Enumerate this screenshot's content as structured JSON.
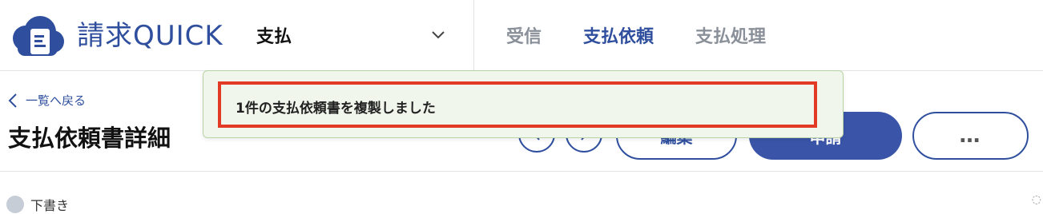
{
  "app": {
    "name": "請求QUICK"
  },
  "header": {
    "module_select": {
      "value": "支払"
    },
    "nav": [
      {
        "label": "受信",
        "active": false
      },
      {
        "label": "支払依頼",
        "active": true
      },
      {
        "label": "支払処理",
        "active": false
      }
    ]
  },
  "page": {
    "back_link": "一覧へ戻る",
    "title": "支払依頼書詳細"
  },
  "actions": {
    "edit_label": "編集",
    "apply_label": "申請",
    "more_label": "…"
  },
  "status": {
    "label": "下書き"
  },
  "toast": {
    "message": "1件の支払依頼書を複製しました"
  },
  "colors": {
    "brand": "#2f4f9e",
    "primary_button": "#3a55a8",
    "toast_bg": "#f1f6ec",
    "highlight": "#e23a24"
  }
}
